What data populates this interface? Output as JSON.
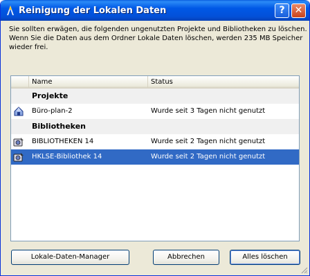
{
  "window": {
    "title": "Reinigung der Lokalen Daten",
    "help_glyph": "?",
    "close_glyph": "✕"
  },
  "message": {
    "line1": "Sie sollten erwägen, die folgenden ungenutzten Projekte und Bibliotheken zu löschen.",
    "line2": "Wenn Sie die Daten aus dem Ordner Lokale Daten löschen, werden 235 MB Speicher",
    "line3": "wieder frei."
  },
  "list": {
    "columns": [
      "Name",
      "Status"
    ],
    "groups": [
      {
        "label": "Projekte",
        "items": [
          {
            "name": "Büro-plan-2",
            "status": "Wurde seit 3 Tagen nicht genutzt",
            "icon": "project-icon",
            "selected": false
          }
        ]
      },
      {
        "label": "Bibliotheken",
        "items": [
          {
            "name": "BIBLIOTHEKEN 14",
            "status": "Wurde seit 2 Tagen nicht genutzt",
            "icon": "library-icon",
            "selected": false
          },
          {
            "name": "HKLSE-Bibliothek 14",
            "status": "Wurde seit 2 Tagen nicht genutzt",
            "icon": "library-icon",
            "selected": true
          }
        ]
      }
    ]
  },
  "buttons": {
    "manager": "Lokale-Daten-Manager",
    "cancel": "Abbrechen",
    "delete_all": "Alles löschen"
  },
  "colors": {
    "titlebar": "#0058e6",
    "selection": "#316ac5",
    "dialog_bg": "#ece9d8"
  }
}
